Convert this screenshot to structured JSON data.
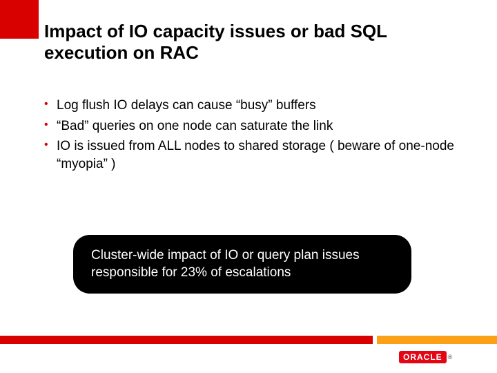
{
  "title": "Impact of IO capacity issues or bad SQL execution on RAC",
  "bullets": {
    "b1": "Log flush IO delays can cause “busy” buffers",
    "b2": "“Bad” queries on one node can saturate the link",
    "b3": "IO is issued from ALL nodes to shared storage ( beware of one-node “myopia” )"
  },
  "callout": "Cluster-wide impact of IO or query plan issues responsible for 23% of escalations",
  "logo": {
    "text": "ORACLE",
    "reg": "®"
  },
  "colors": {
    "red": "#d90000",
    "orange": "#fca018",
    "black": "#000000"
  }
}
